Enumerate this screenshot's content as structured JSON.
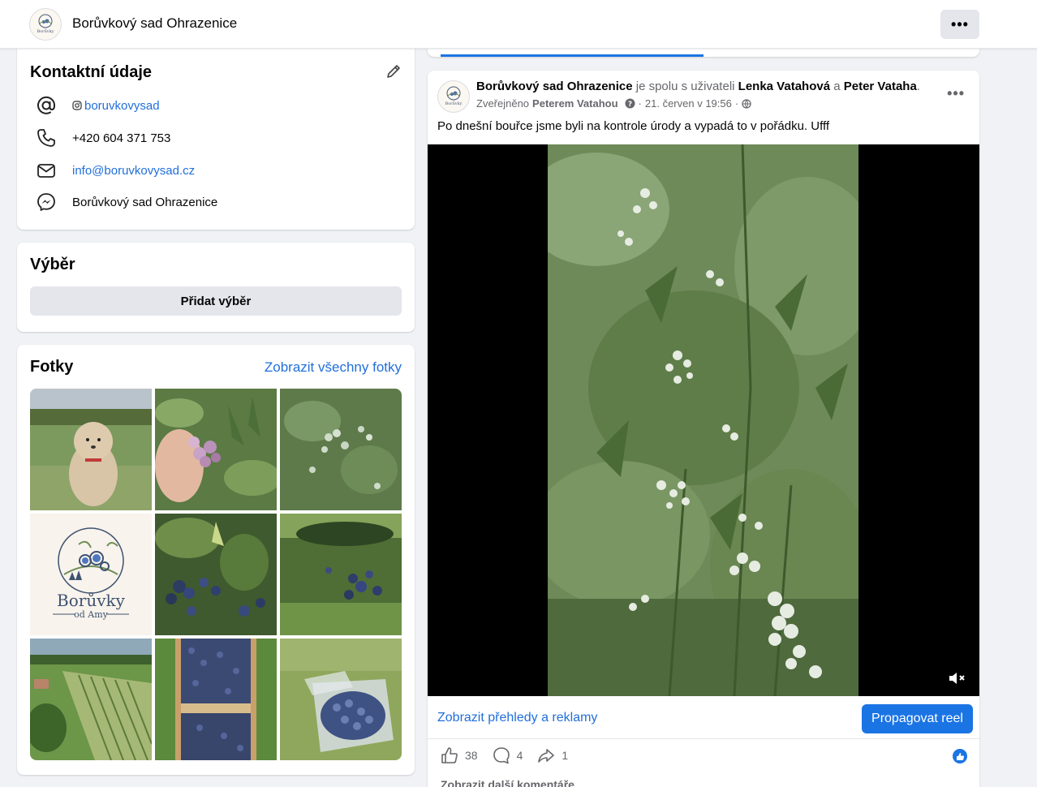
{
  "header": {
    "page_name": "Borůvkový sad Ohrazenice",
    "more_label": "•••"
  },
  "contact": {
    "title": "Kontaktní údaje",
    "instagram": "boruvkovysad",
    "phone": "+420 604 371 753",
    "email": "info@boruvkovysad.cz",
    "messenger": "Borůvkový sad Ohrazenice"
  },
  "selection": {
    "title": "Výběr",
    "add_label": "Přidat výběr"
  },
  "photos": {
    "title": "Fotky",
    "see_all": "Zobrazit všechny fotky",
    "logo_text": "Borůvky",
    "logo_sub": "od Amy"
  },
  "post": {
    "author": "Borůvkový sad Ohrazenice",
    "with_text": "je spolu s uživateli",
    "tag1": "Lenka Vatahová",
    "and_text": "a",
    "tag2": "Peter Vataha",
    "posted_by_prefix": "Zveřejněno",
    "posted_by": "Peterem Vatahou",
    "date": "21. červen v 19:56",
    "more_label": "•••",
    "text": "Po dnešní bouřce jsme byli na kontrole úrody a vypadá to v pořádku. Ufff",
    "insights_label": "Zobrazit přehledy a reklamy",
    "boost_label": "Propagovat reel",
    "likes": "38",
    "comments": "4",
    "shares": "1",
    "more_comments": "Zobrazit další komentáře"
  },
  "colors": {
    "accent": "#1b74e4",
    "link": "#216fdb",
    "background": "#f0f2f5"
  }
}
